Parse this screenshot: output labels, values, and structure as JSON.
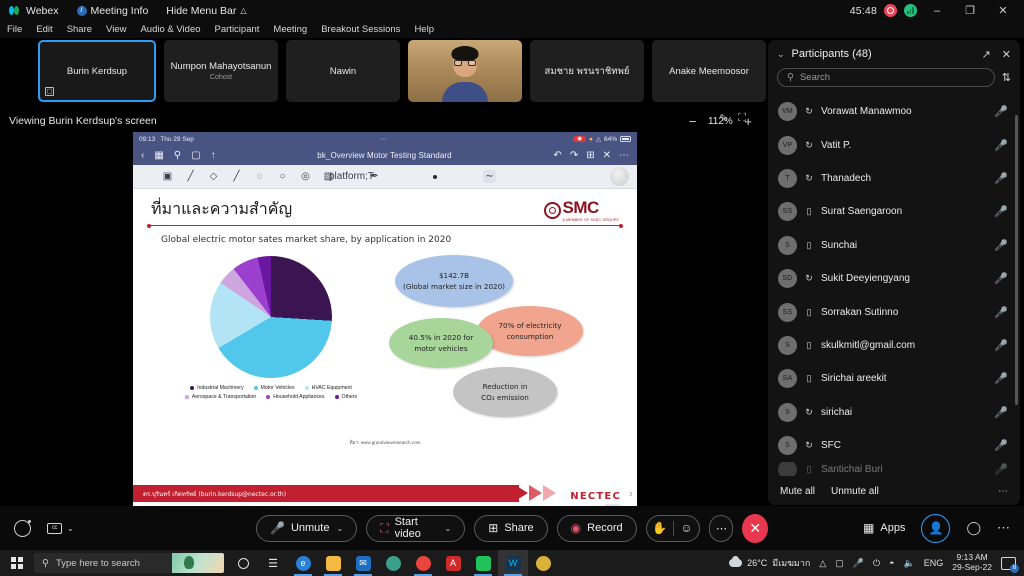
{
  "titlebar": {
    "app_name": "Webex",
    "meeting_info": "Meeting Info",
    "hide_menu_bar": "Hide Menu Bar",
    "timer": "45:48",
    "minimize": "–",
    "restore": "❐",
    "close": "✕"
  },
  "menubar": {
    "items": [
      "File",
      "Edit",
      "Share",
      "View",
      "Audio & Video",
      "Participant",
      "Meeting",
      "Breakout Sessions",
      "Help"
    ]
  },
  "thumbnails": [
    {
      "name": "Burin Kerdsup",
      "sub": "",
      "active": true
    },
    {
      "name": "Numpon Mahayotsanun",
      "sub": "Cohost",
      "active": false
    },
    {
      "name": "Nawin",
      "sub": "",
      "active": false
    },
    {
      "name": "",
      "sub": "",
      "active": false
    },
    {
      "name": "สมชาย พรนราชิทพย์",
      "sub": "",
      "active": false
    },
    {
      "name": "Anake Meemoosor",
      "sub": "",
      "active": false
    }
  ],
  "viewbar": {
    "label": "Viewing Burin Kerdsup's screen",
    "zoom_out": "−",
    "zoom_level": "112%",
    "zoom_in": "+"
  },
  "shared_screen": {
    "ipad_status": {
      "time": "09:13",
      "date": "Thu 29 Sep",
      "battery": "64%"
    },
    "document_title": "bk_Overview Motor Testing Standard",
    "slide": {
      "title": "ที่มาและความสำคัญ",
      "logo_text": "SMC",
      "logo_sub": "A MEMBER OF SDEC GROUPS",
      "subtitle": "Global electric motor sates market share, by application in 2020",
      "bubbles": [
        {
          "lines": [
            "$142.7B",
            "(Global market size in 2020)"
          ],
          "color": "#a9c3e8"
        },
        {
          "lines": [
            "70% of electricity",
            "consumption"
          ],
          "color": "#f2a58e"
        },
        {
          "lines": [
            "40.5% in 2020 for",
            "motor vehicles"
          ],
          "color": "#a8d59a"
        },
        {
          "lines": [
            "Reduction in",
            "CO₂ emission"
          ],
          "color": "#c4c4c4"
        }
      ],
      "source": "ที่มา: www.grandviewresearch.com",
      "footer": "ดร.บุรินทร์  เกิดทรัพย์ (burin.kerdsup@nectec.or.th)",
      "nectec": "NECTEC",
      "nectec_sub": "NSTDA",
      "page_number": "3"
    }
  },
  "chart_data": {
    "type": "pie",
    "title": "Global electric motor sates market share, by application in 2020",
    "categories": [
      "Industrial Machinery",
      "Motor Vehicles",
      "HVAC Equipment",
      "Aerospace & Transportation",
      "Household Appliances",
      "Others"
    ],
    "values": [
      26,
      40.5,
      18,
      5,
      7,
      3.5
    ],
    "colors": [
      "#3b1452",
      "#52c7ec",
      "#b3e4f6",
      "#cfa5e0",
      "#9a3fce",
      "#6a17a0"
    ],
    "legend_position": "bottom",
    "source": "www.grandviewresearch.com"
  },
  "panel": {
    "title": "Participants (48)",
    "search_placeholder": "Search",
    "collapse_icon": "⌄",
    "popout_icon": "↗",
    "close_icon": "✕",
    "sort_icon": "⇅",
    "participants": [
      {
        "initials": "",
        "name": "Santichai Buri",
        "device": "phone",
        "muted": true,
        "partial": true
      },
      {
        "initials": "S",
        "name": "SFC",
        "device": "headset",
        "muted": true
      },
      {
        "initials": "S",
        "name": "sirichai",
        "device": "headset",
        "muted": true
      },
      {
        "initials": "SA",
        "name": "Sirichai areekit",
        "device": "phone",
        "muted": true
      },
      {
        "initials": "S",
        "name": "skulkmitl@gmail.com",
        "device": "phone",
        "muted": true
      },
      {
        "initials": "SS",
        "name": "Sorrakan Sutinno",
        "device": "phone",
        "muted": true
      },
      {
        "initials": "SD",
        "name": "Sukit Deeyiengyang",
        "device": "headset",
        "muted": true
      },
      {
        "initials": "S",
        "name": "Sunchai",
        "device": "phone",
        "muted": true
      },
      {
        "initials": "SS",
        "name": "Surat Saengaroon",
        "device": "phone",
        "muted": true
      },
      {
        "initials": "T",
        "name": "Thanadech",
        "device": "headset",
        "muted": true
      },
      {
        "initials": "VP",
        "name": "Vatit P.",
        "device": "headset",
        "muted": true
      },
      {
        "initials": "VM",
        "name": "Vorawat Manawmoo",
        "device": "headset",
        "muted": true
      }
    ],
    "mute_all": "Mute all",
    "unmute_all": "Unmute all",
    "more": "⋯"
  },
  "controls": {
    "unmute": "Unmute",
    "start_video": "Start video",
    "share": "Share",
    "record": "Record",
    "apps": "Apps",
    "caret": "⌄",
    "more": "⋯",
    "end_call": "✕"
  },
  "taskbar": {
    "search_placeholder": "Type here to search",
    "weather_temp": "26°C",
    "weather_desc": "มีเมฆมาก",
    "language": "ENG",
    "time": "9:13 AM",
    "date": "29-Sep-22",
    "notif_count": "8"
  }
}
